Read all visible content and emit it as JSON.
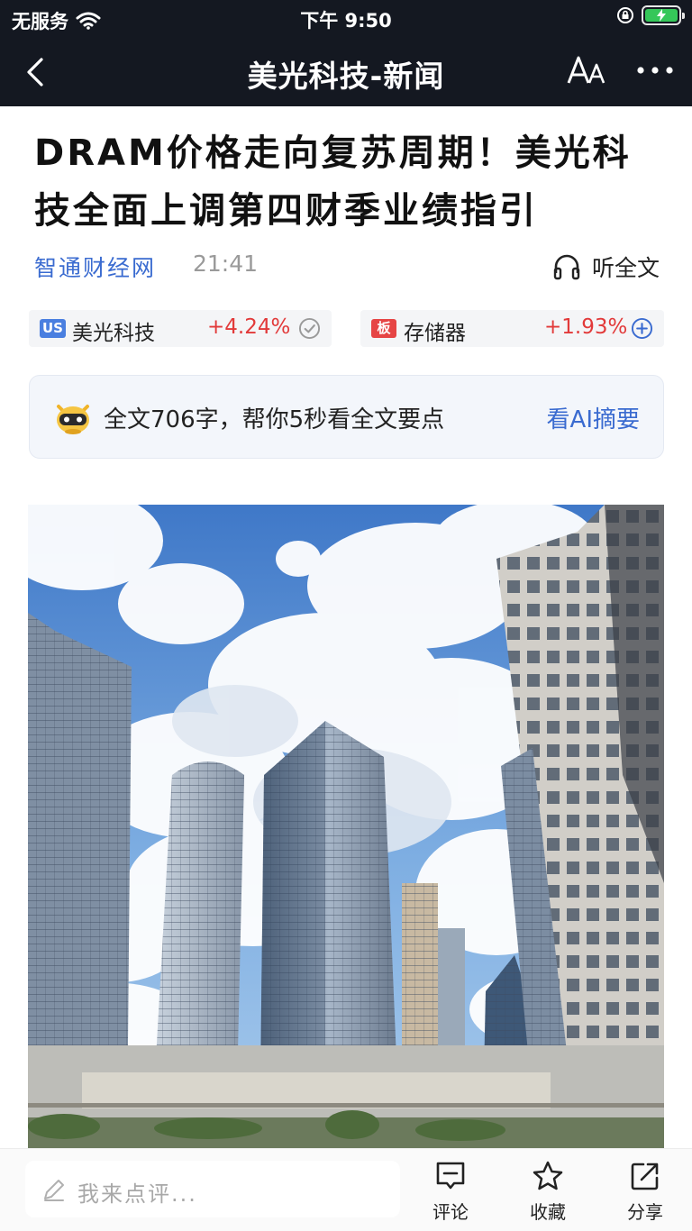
{
  "status_bar": {
    "carrier": "无服务",
    "time": "下午 9:50"
  },
  "nav": {
    "title": "美光科技-新闻",
    "font_button": "AA"
  },
  "article": {
    "headline": "DRAM价格走向复苏周期！美光科技全面上调第四财季业绩指引",
    "source": "智通财经网",
    "time": "21:41",
    "listen_label": "听全文"
  },
  "stocks": [
    {
      "tag": "US",
      "tag_color": "#4a7fe0",
      "name": "美光科技",
      "change": "+4.24%",
      "action_icon": "check-circle-icon"
    },
    {
      "tag": "板",
      "tag_color": "#e64545",
      "name": "存储器",
      "change": "+1.93%",
      "action_icon": "plus-circle-icon"
    }
  ],
  "ai_summary": {
    "text": "全文706字，帮你5秒看全文要点",
    "link": "看AI摘要"
  },
  "bottom_bar": {
    "comment_placeholder": "我来点评...",
    "actions": [
      {
        "label": "评论",
        "icon": "comment-icon"
      },
      {
        "label": "收藏",
        "icon": "star-icon"
      },
      {
        "label": "分享",
        "icon": "share-icon"
      }
    ]
  },
  "colors": {
    "nav_bg": "#141821",
    "link_blue": "#3a6bd0",
    "up_red": "#e23a3a"
  }
}
